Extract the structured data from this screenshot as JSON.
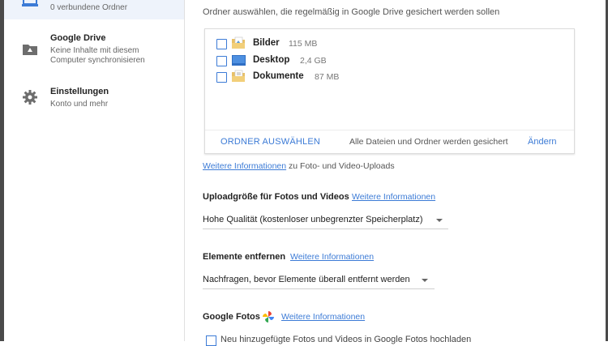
{
  "sidebar": {
    "computer": {
      "subtitle": "0 verbundene Ordner"
    },
    "drive": {
      "title": "Google Drive",
      "subtitle_line1": "Keine Inhalte mit diesem",
      "subtitle_line2": "Computer synchronisieren"
    },
    "settings": {
      "title": "Einstellungen",
      "subtitle": "Konto und mehr"
    }
  },
  "main": {
    "instruction": "Ordner auswählen, die regelmäßig in Google Drive gesichert werden sollen",
    "folders": [
      {
        "name": "Bilder",
        "size": "115 MB",
        "checked": false
      },
      {
        "name": "Desktop",
        "size": "2,4 GB",
        "checked": false
      },
      {
        "name": "Dokumente",
        "size": "87 MB",
        "checked": false
      }
    ],
    "choose_folder_label": "ORDNER AUSWÄHLEN",
    "backup_info": "Alle Dateien und Ordner werden gesichert",
    "change_label": "Ändern",
    "more_info_uploads_link": "Weitere Informationen",
    "more_info_uploads_text": " zu Foto- und Video-Uploads",
    "upload_size": {
      "title": "Uploadgröße für Fotos und Videos",
      "link": "Weitere Informationen",
      "selected": "Hohe Qualität (kostenloser unbegrenzter Speicherplatz)"
    },
    "remove_items": {
      "title": "Elemente entfernen",
      "link": "Weitere Informationen",
      "selected": "Nachfragen, bevor Elemente überall entfernt werden"
    },
    "google_photos": {
      "title": "Google Fotos",
      "link": "Weitere Informationen",
      "checkbox_label": "Neu hinzugefügte Fotos und Videos in Google Fotos hochladen"
    }
  },
  "colors": {
    "accent": "#3c7bd6",
    "border": "#4a4a4a"
  }
}
